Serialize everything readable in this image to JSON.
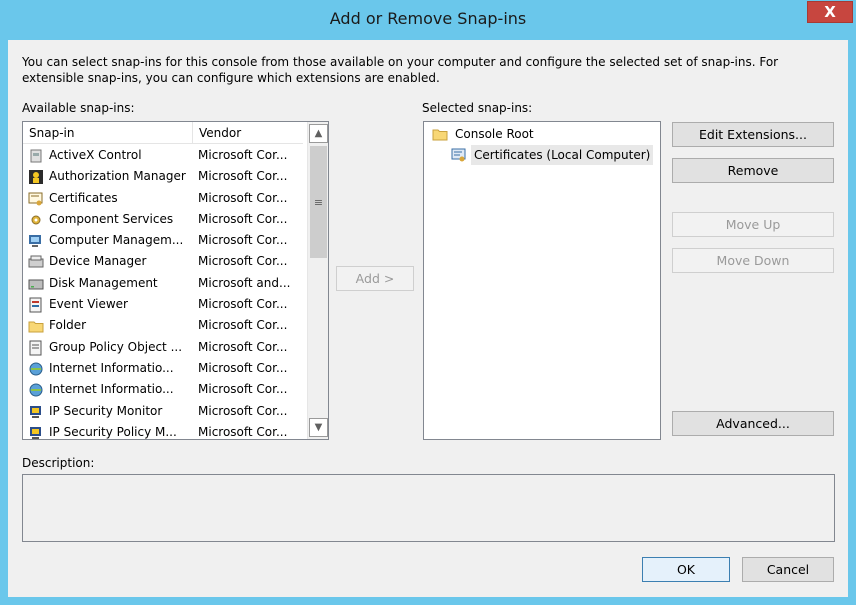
{
  "window": {
    "title": "Add or Remove Snap-ins",
    "close_glyph": "X",
    "intro": "You can select snap-ins for this console from those available on your computer and configure the selected set of snap-ins. For extensible snap-ins, you can configure which extensions are enabled."
  },
  "available": {
    "label": "Available snap-ins:",
    "columns": [
      "Snap-in",
      "Vendor"
    ],
    "rows": [
      {
        "name": "ActiveX Control",
        "vendor": "Microsoft Cor...",
        "icon": "activex-icon"
      },
      {
        "name": "Authorization Manager",
        "vendor": "Microsoft Cor...",
        "icon": "authorization-icon"
      },
      {
        "name": "Certificates",
        "vendor": "Microsoft Cor...",
        "icon": "certificate-icon"
      },
      {
        "name": "Component Services",
        "vendor": "Microsoft Cor...",
        "icon": "component-services-icon"
      },
      {
        "name": "Computer Managem...",
        "vendor": "Microsoft Cor...",
        "icon": "computer-management-icon"
      },
      {
        "name": "Device Manager",
        "vendor": "Microsoft Cor...",
        "icon": "device-manager-icon"
      },
      {
        "name": "Disk Management",
        "vendor": "Microsoft and...",
        "icon": "disk-management-icon"
      },
      {
        "name": "Event Viewer",
        "vendor": "Microsoft Cor...",
        "icon": "event-viewer-icon"
      },
      {
        "name": "Folder",
        "vendor": "Microsoft Cor...",
        "icon": "folder-icon"
      },
      {
        "name": "Group Policy Object ...",
        "vendor": "Microsoft Cor...",
        "icon": "group-policy-icon"
      },
      {
        "name": "Internet Informatio...",
        "vendor": "Microsoft Cor...",
        "icon": "iis-icon"
      },
      {
        "name": "Internet Informatio...",
        "vendor": "Microsoft Cor...",
        "icon": "iis-icon"
      },
      {
        "name": "IP Security Monitor",
        "vendor": "Microsoft Cor...",
        "icon": "ip-security-icon"
      },
      {
        "name": "IP Security Policy M...",
        "vendor": "Microsoft Cor...",
        "icon": "ip-security-policy-icon"
      }
    ]
  },
  "add_button": "Add >",
  "selected": {
    "label": "Selected snap-ins:",
    "root": "Console Root",
    "child": "Certificates (Local Computer)"
  },
  "side_buttons": {
    "edit_extensions": "Edit Extensions...",
    "remove": "Remove",
    "move_up": "Move Up",
    "move_down": "Move Down",
    "advanced": "Advanced..."
  },
  "description": {
    "label": "Description:"
  },
  "footer": {
    "ok": "OK",
    "cancel": "Cancel"
  },
  "colors": {
    "titlebar": "#6ac7eb",
    "close": "#c7463f",
    "dialog_bg": "#f0f0f0"
  }
}
